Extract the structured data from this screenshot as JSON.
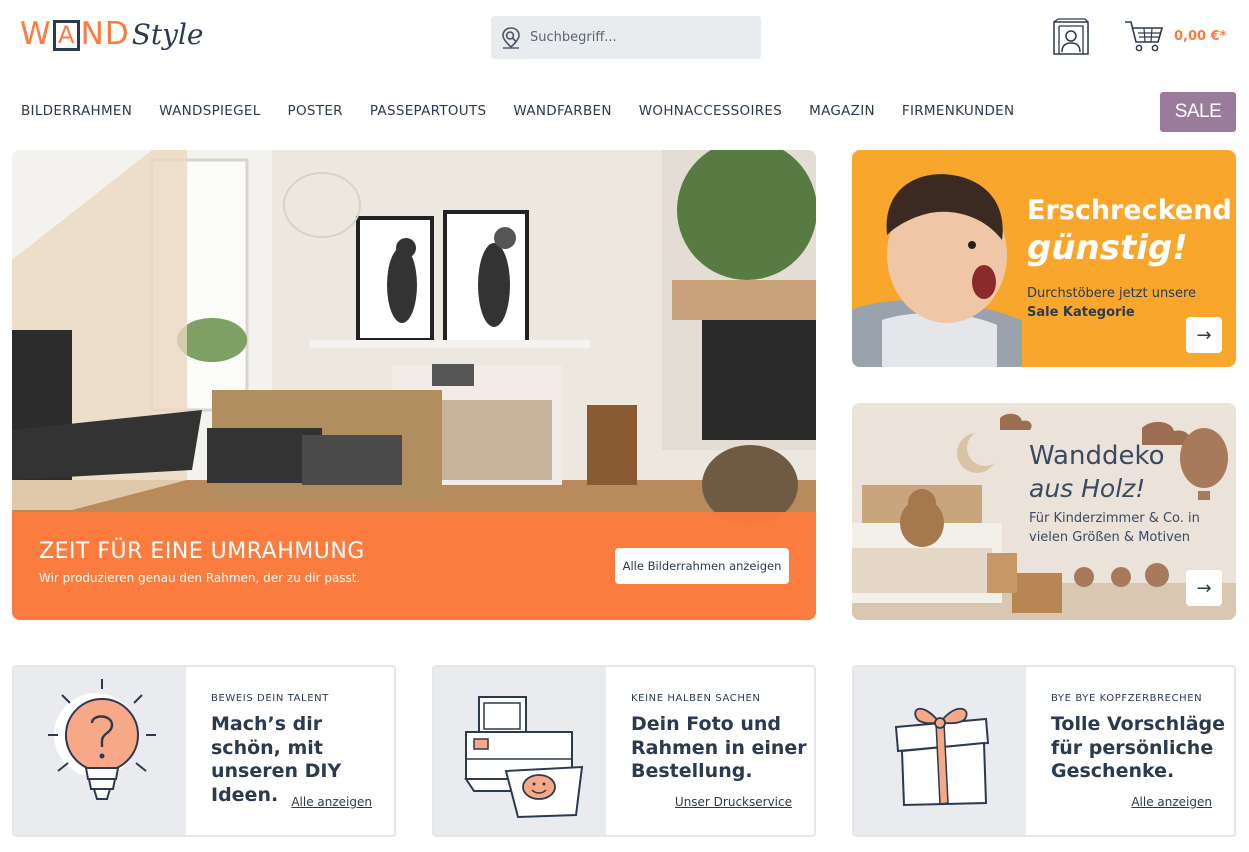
{
  "header": {
    "logo_w": "W",
    "logo_a": "A",
    "logo_nd": "ND",
    "logo_style": "Style",
    "search_placeholder": "Suchbegriff...",
    "cart_total": "0,00 €*"
  },
  "nav": {
    "items": [
      "BILDERRAHMEN",
      "WANDSPIEGEL",
      "POSTER",
      "PASSEPARTOUTS",
      "WANDFARBEN",
      "WOHNACCESSOIRES",
      "MAGAZIN",
      "FIRMENKUNDEN"
    ],
    "sale_label": "SALE"
  },
  "hero": {
    "title": "ZEIT FÜR EINE UMRAHMUNG",
    "subtitle": "Wir produzieren genau den Rahmen, der zu dir passt.",
    "button_label": "Alle Bilderrahmen anzeigen"
  },
  "banner_sale": {
    "title1": "Erschreckend",
    "title2": "günstig!",
    "text_plain": "Durchstöbere jetzt unsere ",
    "text_bold": "Sale Kategorie",
    "arrow": "→"
  },
  "banner_wood": {
    "title1": "Wanddeko",
    "title2": "aus Holz!",
    "text": "Für Kinderzimmer & Co. in vielen Größen & Motiven",
    "arrow": "→"
  },
  "cards": [
    {
      "kicker": "BEWEIS DEIN TALENT",
      "title": "Mach’s dir schön, mit unseren DIY Ideen.",
      "link": "Alle anzeigen",
      "icon": "lightbulb-icon"
    },
    {
      "kicker": "KEINE HALBEN SACHEN",
      "title": "Dein Foto und Rahmen in einer Bestellung.",
      "link": "Unser Druckservice",
      "icon": "printer-icon"
    },
    {
      "kicker": "BYE BYE KOPFZERBRECHEN",
      "title": "Tolle Vorschläge für persönliche Geschenke.",
      "link": "Alle anzeigen",
      "icon": "gift-icon"
    }
  ],
  "colors": {
    "accent": "#ff7a3d",
    "navy": "#2b3a4f",
    "sale": "#9b7b9b",
    "banner_orange": "#f9a62c"
  }
}
